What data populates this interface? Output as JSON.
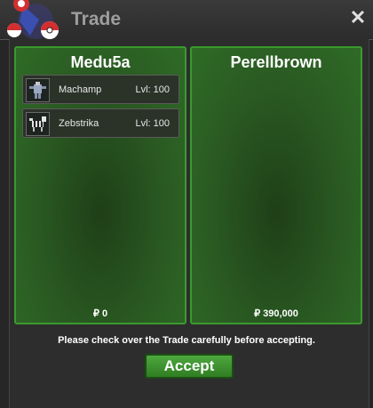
{
  "window": {
    "title": "Trade",
    "close_icon": "close-icon"
  },
  "left": {
    "name": "Medu5a",
    "money": "₽ 0",
    "pokemon": [
      {
        "name": "Machamp",
        "level": "Lvl: 100",
        "icon": "machamp-sprite-icon"
      },
      {
        "name": "Zebstrika",
        "level": "Lvl: 100",
        "icon": "zebstrika-sprite-icon"
      }
    ]
  },
  "right": {
    "name": "Perellbrown",
    "money": "₽ 390,000"
  },
  "footer": {
    "notice": "Please check over the Trade carefully before accepting.",
    "accept_label": "Accept"
  },
  "colors": {
    "panel_border": "#3a9a2e",
    "panel_bg": "#2a5a22",
    "accept_button": "#3f9430",
    "window_bg": "#262626"
  }
}
